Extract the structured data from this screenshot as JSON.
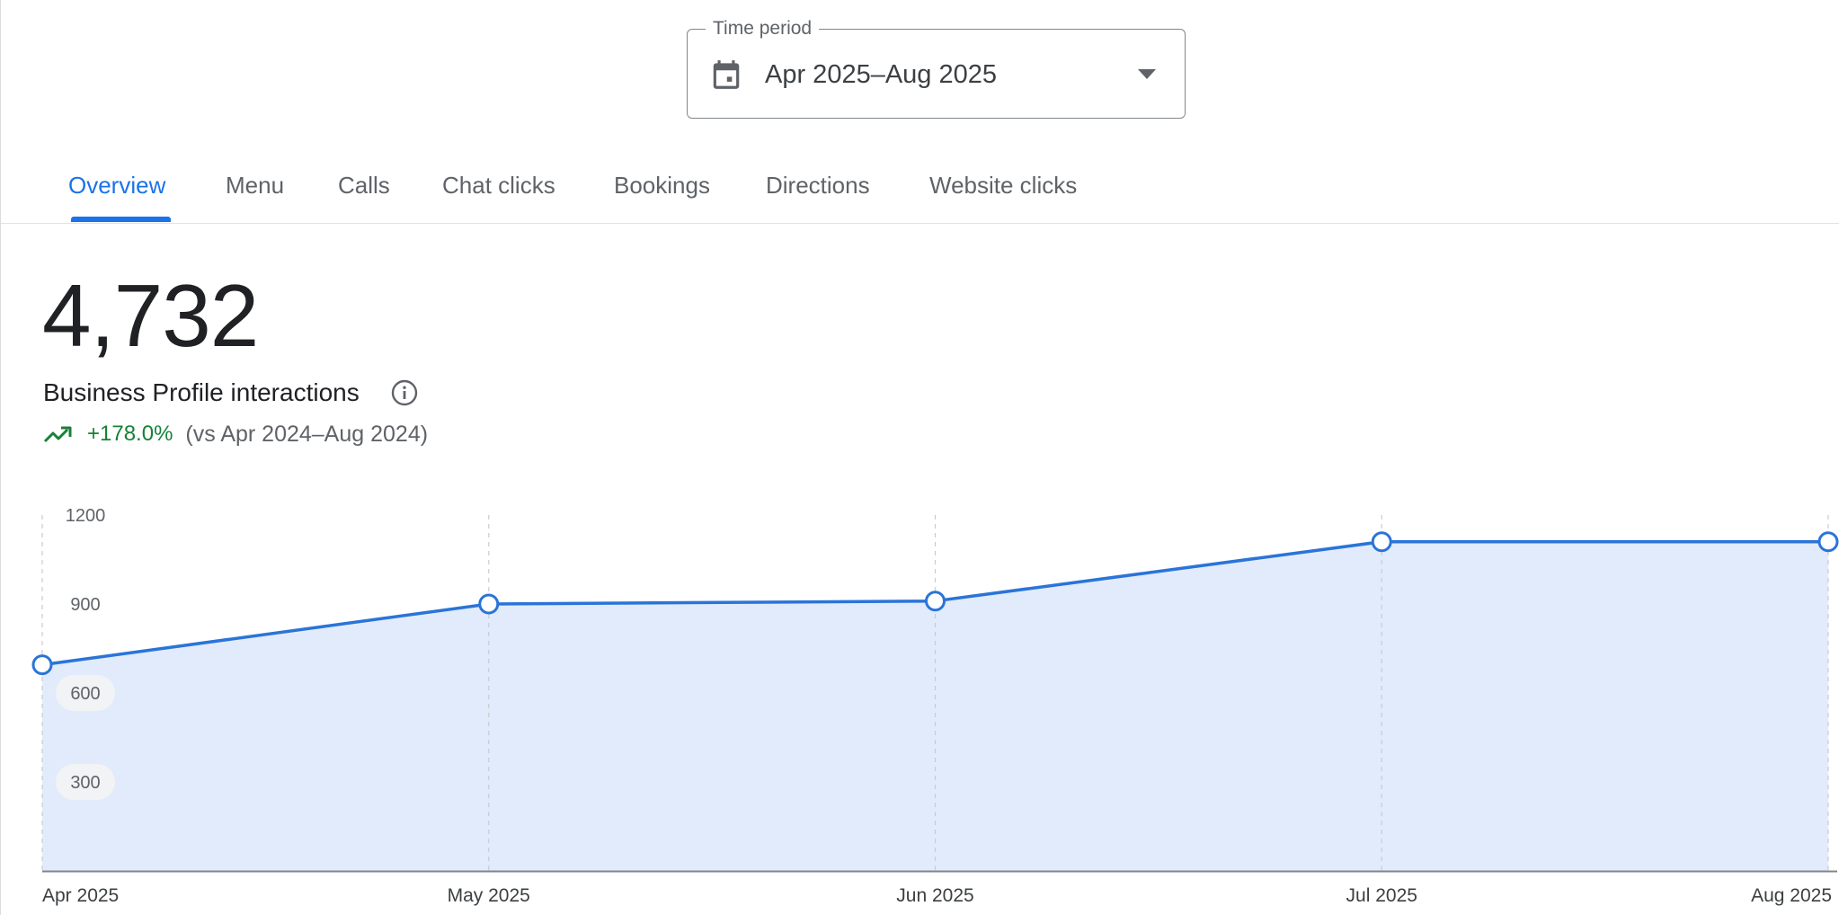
{
  "time_period": {
    "legend": "Time period",
    "value": "Apr 2025–Aug 2025"
  },
  "icons": {
    "calendar": "calendar-icon",
    "dropdown": "chevron-down-icon",
    "info": "info-icon",
    "trend": "trending-up-icon"
  },
  "tabs": [
    {
      "label": "Overview",
      "active": true
    },
    {
      "label": "Menu",
      "active": false
    },
    {
      "label": "Calls",
      "active": false
    },
    {
      "label": "Chat clicks",
      "active": false
    },
    {
      "label": "Bookings",
      "active": false
    },
    {
      "label": "Directions",
      "active": false
    },
    {
      "label": "Website clicks",
      "active": false
    }
  ],
  "metric": {
    "value": "4,732",
    "label": "Business Profile interactions",
    "change": "+178.0%",
    "comparison": "(vs Apr 2024–Aug 2024)"
  },
  "colors": {
    "accent": "#1a73e8",
    "line": "#2a74d8",
    "area_fill": "#e2ebfb",
    "positive": "#188038"
  },
  "chart_data": {
    "type": "area",
    "categories": [
      "Apr 2025",
      "May 2025",
      "Jun 2025",
      "Jul 2025",
      "Aug 2025"
    ],
    "values": [
      695,
      900,
      910,
      1110,
      1110
    ],
    "yticks": [
      300,
      600,
      900,
      1200
    ],
    "ylim": [
      0,
      1200
    ],
    "grid": "vertical-dashed"
  }
}
